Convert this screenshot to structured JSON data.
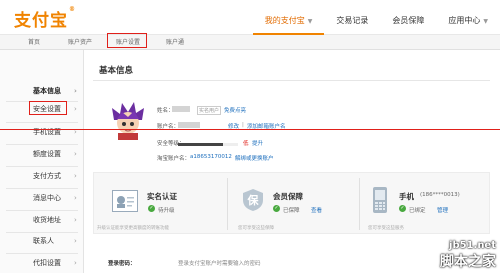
{
  "header": {
    "logo": "支付宝",
    "logo_mark": "®",
    "nav": [
      {
        "label": "我的支付宝",
        "active": true,
        "dropdown": true
      },
      {
        "label": "交易记录",
        "active": false,
        "dropdown": false
      },
      {
        "label": "会员保障",
        "active": false,
        "dropdown": false
      },
      {
        "label": "应用中心",
        "active": false,
        "dropdown": true
      }
    ]
  },
  "subnav": [
    "首页",
    "账户资产",
    "账户设置",
    "账户通"
  ],
  "sidebar": {
    "items": [
      {
        "label": "基本信息",
        "active": true
      },
      {
        "label": "安全设置",
        "active": false
      },
      {
        "label": "手机设置",
        "active": false
      },
      {
        "label": "额度设置",
        "active": false
      },
      {
        "label": "支付方式",
        "active": false
      },
      {
        "label": "消息中心",
        "active": false
      },
      {
        "label": "收货地址",
        "active": false
      },
      {
        "label": "联系人",
        "active": false
      },
      {
        "label": "代扣设置",
        "active": false
      }
    ]
  },
  "main": {
    "title": "基本信息",
    "name_label": "姓名：",
    "name_badge": "实名用户",
    "name_link": "免费点亮",
    "account_label": "账户名：",
    "account_links": [
      "修改",
      "添加邮箱账户名"
    ],
    "security_label": "安全等级：",
    "security_level_text": "低",
    "security_level": 0.75,
    "security_link": "提升",
    "taobao_label": "淘宝账户名：",
    "taobao_value": "a18653170012",
    "taobao_link": "解绑或更换账户",
    "cards": [
      {
        "title": "实名认证",
        "status": "待升级",
        "desc": "升级认证能享受更高额度的转账功能",
        "action": ""
      },
      {
        "title": "会员保障",
        "status": "已保障",
        "desc": "您可享受这些保障",
        "action": "查看"
      },
      {
        "title": "手机",
        "phone": "(186****0013)",
        "status": "已绑定",
        "desc": "您可享受这些服务",
        "action": "管理"
      }
    ],
    "bottom_label": "登录密码：",
    "bottom_text": "登录支付宝账户时需要输入的密码"
  },
  "watermark": {
    "url": "jb51.net",
    "name": "脚本之家"
  },
  "colors": {
    "brand": "#f08300",
    "link": "#1c6ebd",
    "annotation": "#e0201a",
    "success": "#49a93f"
  }
}
